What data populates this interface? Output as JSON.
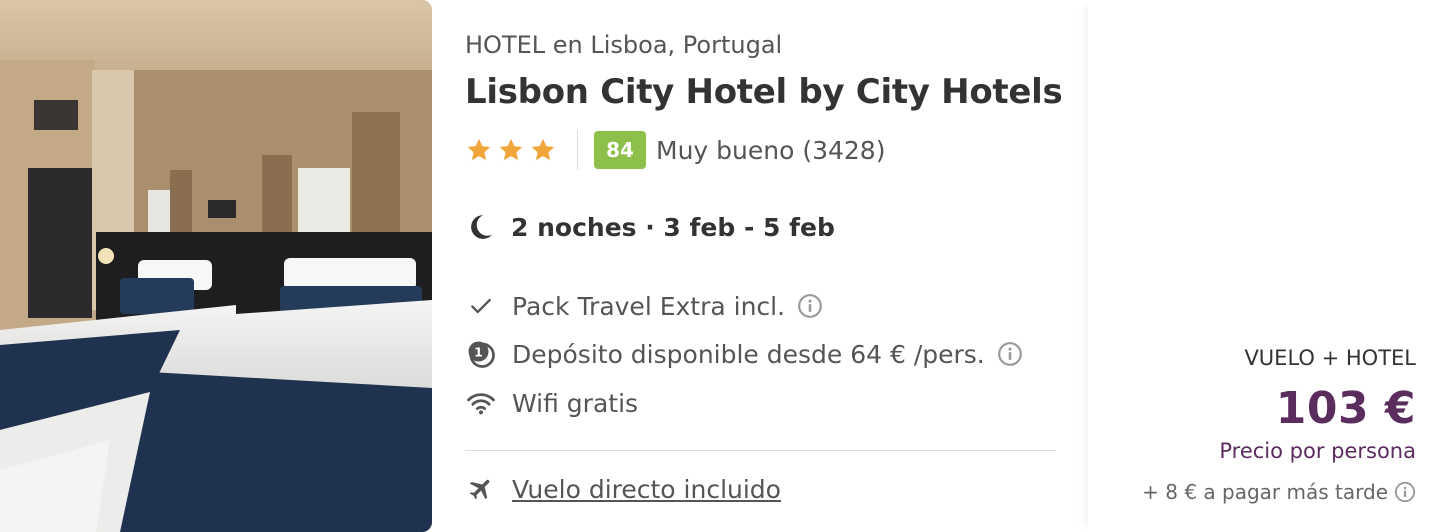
{
  "hotel": {
    "category_location": "HOTEL en Lisboa, Portugal",
    "name": "Lisbon City Hotel by City Hotels",
    "stars": 3,
    "score": "84",
    "score_text": "Muy bueno (3428)",
    "score_color": "#8cc04a",
    "photo_icon": "hotel-room-photo"
  },
  "stay": {
    "icon": "moon-icon",
    "text": "2 noches · 3 feb - 5 feb"
  },
  "features": [
    {
      "icon": "check-icon",
      "text": "Pack Travel Extra incl.",
      "info": true
    },
    {
      "icon": "deposit-icon",
      "text": "Depósito disponible desde 64 € /pers.",
      "info": true
    },
    {
      "icon": "wifi-icon",
      "text": "Wifi gratis",
      "info": false
    }
  ],
  "flight": {
    "icon": "plane-icon",
    "link_text": "Vuelo directo incluido"
  },
  "price": {
    "label": "VUELO + HOTEL",
    "amount": "103 €",
    "per_person": "Precio por persona",
    "later": "+ 8 € a pagar más tarde",
    "accent": "#5b2d5f"
  },
  "colors": {
    "star": "#f0a53a",
    "text_dark": "#333333",
    "text_muted": "#555555"
  }
}
